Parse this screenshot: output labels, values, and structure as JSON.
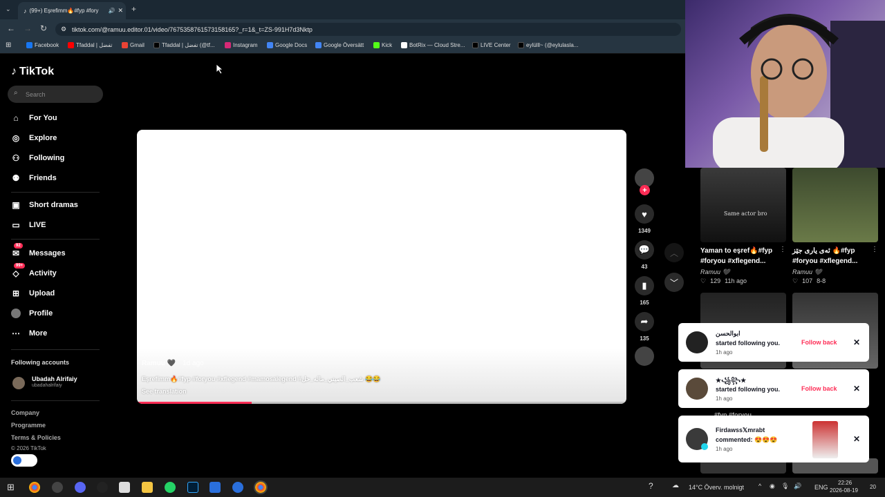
{
  "browser": {
    "tab_title": "(99+) Eşrefimm🔥#fyp #fory",
    "url": "tiktok.com/@ramuu.editor.01/video/7675358761573158165?_r=1&_t=ZS-991H7d3Nktp",
    "bookmarks": [
      {
        "label": "Facebook",
        "color": "#1877f2"
      },
      {
        "label": "Tfaddal | تفضل",
        "color": "#ff0000"
      },
      {
        "label": "Gmail",
        "color": "#ea4335"
      },
      {
        "label": "Tfaddal | تفضل (@tf...",
        "color": "#000000"
      },
      {
        "label": "Instagram",
        "color": "#d62976"
      },
      {
        "label": "Google Docs",
        "color": "#4285f4"
      },
      {
        "label": "Google Översätt",
        "color": "#4285f4"
      },
      {
        "label": "Kick",
        "color": "#53fc18"
      },
      {
        "label": "BotRix — Cloud Stre...",
        "color": "#ffffff"
      },
      {
        "label": "LIVE Center",
        "color": "#000000"
      },
      {
        "label": "eylülll~ (@eylulasla...",
        "color": "#000000"
      }
    ]
  },
  "sidebar": {
    "logo": "TikTok",
    "search_placeholder": "Search",
    "nav": [
      {
        "label": "For You",
        "icon": "home-icon"
      },
      {
        "label": "Explore",
        "icon": "compass-icon"
      },
      {
        "label": "Following",
        "icon": "following-icon"
      },
      {
        "label": "Friends",
        "icon": "friends-icon"
      },
      {
        "label": "Short dramas",
        "icon": "dramas-icon"
      },
      {
        "label": "LIVE",
        "icon": "live-icon"
      },
      {
        "label": "Messages",
        "icon": "messages-icon",
        "badge": "92"
      },
      {
        "label": "Activity",
        "icon": "activity-icon",
        "badge": "99+"
      },
      {
        "label": "Upload",
        "icon": "upload-icon"
      },
      {
        "label": "Profile",
        "icon": "profile-icon"
      },
      {
        "label": "More",
        "icon": "more-icon"
      }
    ],
    "following_title": "Following accounts",
    "following_account": {
      "name": "Ubadah Alrifaiy",
      "handle": "ubadahalrifaiy"
    },
    "footer": [
      "Company",
      "Programme",
      "Terms & Policies"
    ],
    "copyright": "© 2026 TikTok"
  },
  "video": {
    "author": "Ramuu 🖤",
    "time": "1d ago",
    "caption": "Eşrefimm🔥#fyp #foryou #xflegend #mamosalegend #شعب_الصيني_ماله_حل 😂😂",
    "see_translation": "See translation",
    "progress_fraction": 0.235
  },
  "actions": {
    "likes": "1349",
    "comments": "43",
    "saves": "165",
    "shares": "135"
  },
  "grid": [
    {
      "title": "Yaman to eşref🔥#fyp #foryou #xflegend...",
      "author": "Ramuu 🖤",
      "likes": "129",
      "time": "11h ago",
      "overlay": "Same actor bro"
    },
    {
      "title": "ئەی یاری جێز 🔥#fyp #foryou #xflegend...",
      "author": "Ramuu 🖤",
      "likes": "107",
      "time": "8-8",
      "overlay": ""
    }
  ],
  "notifications": [
    {
      "name": "ابوالحسن",
      "text": "started following you.",
      "time": "1h ago",
      "action": "Follow back"
    },
    {
      "name": "★꧁꧂★",
      "text": "started following you.",
      "time": "1h ago",
      "action": "Follow back"
    },
    {
      "name": "Firdawss𝕏mrabt",
      "text": "commented: 😍😍😍",
      "time": "1h ago",
      "action": ""
    }
  ],
  "taskbar": {
    "weather": "14°C  Överv. molnigt",
    "lang": "ENG",
    "time": "22:26",
    "date": "2026-08-19",
    "notif_count": "20"
  }
}
